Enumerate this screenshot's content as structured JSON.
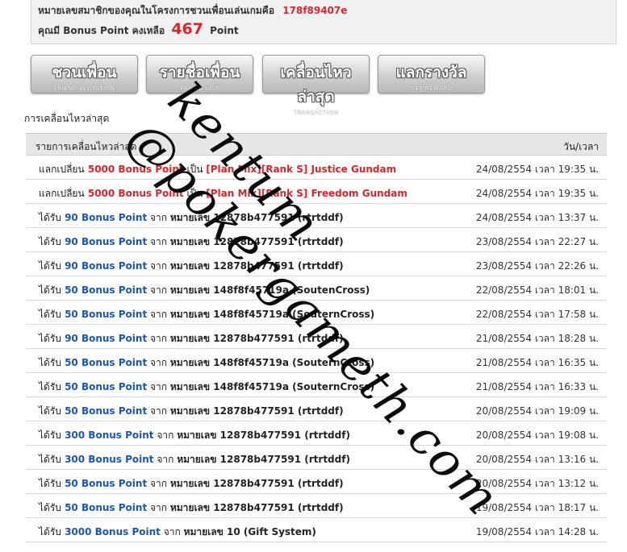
{
  "header": {
    "member_prefix": "หมายเลขสมาชิกของคุณในโครงการชวนเพื่อนเล่นเกมคือ",
    "member_id": "178f89407e",
    "points_prefix": "คุณมี Bonus Point คงเหลือ",
    "points_value": "467",
    "points_suffix": "Point"
  },
  "nav": [
    {
      "th": "ชวนเพื่อน",
      "en": "FRIEND INVITATION"
    },
    {
      "th": "รายชื่อเพื่อน",
      "en": "FRIEND LIST"
    },
    {
      "th": "เคลื่อนไหวล่าสุด",
      "en": "TRANSACTION"
    },
    {
      "th": "แลกรางวัล",
      "en": "GET REWARD"
    }
  ],
  "section_title": "การเคลื่อนไหวล่าสุด",
  "table": {
    "col_left": "รายการเคลื่อนไหวล่าสุด",
    "col_right": "วัน/เวลา",
    "rows": [
      {
        "act": "แลกเปลี่ยน",
        "amt": "5000 Bonus Point",
        "mid": " เป็น ",
        "item": "[Plan Mix][Rank S] Justice Gundam",
        "time": "24/08/2554 เวลา 19:35 น."
      },
      {
        "act": "แลกเปลี่ยน",
        "amt": "5000 Bonus Point",
        "mid": " เป็น ",
        "item": "[Plan Mix][Rank S] Freedom Gundam",
        "time": "24/08/2554 เวลา 19:35 น."
      },
      {
        "act": "ได้รับ",
        "amt": "90 Bonus Point",
        "frm": " จาก ",
        "src": "หมายเลข 12878b477591 (rtrtddf)",
        "time": "24/08/2554 เวลา 13:37 น."
      },
      {
        "act": "ได้รับ",
        "amt": "90 Bonus Point",
        "frm": " จาก ",
        "src": "หมายเลข 12878b477591 (rtrtddf)",
        "time": "23/08/2554 เวลา 22:27 น."
      },
      {
        "act": "ได้รับ",
        "amt": "90 Bonus Point",
        "frm": " จาก ",
        "src": "หมายเลข 12878b477591 (rtrtddf)",
        "time": "23/08/2554 เวลา 22:26 น."
      },
      {
        "act": "ได้รับ",
        "amt": "50 Bonus Point",
        "frm": " จาก ",
        "src": "หมายเลข 148f8f45719a (SoutenCross)",
        "time": "22/08/2554 เวลา 18:01 น."
      },
      {
        "act": "ได้รับ",
        "amt": "50 Bonus Point",
        "frm": " จาก ",
        "src": "หมายเลข 148f8f45719a (SouternCross)",
        "time": "22/08/2554 เวลา 17:58 น."
      },
      {
        "act": "ได้รับ",
        "amt": "90 Bonus Point",
        "frm": " จาก ",
        "src": "หมายเลข 12878b477591 (rtrtddf)",
        "time": "21/08/2554 เวลา 18:28 น."
      },
      {
        "act": "ได้รับ",
        "amt": "50 Bonus Point",
        "frm": " จาก ",
        "src": "หมายเลข 148f8f45719a (SouternCross)",
        "time": "21/08/2554 เวลา 16:35 น."
      },
      {
        "act": "ได้รับ",
        "amt": "50 Bonus Point",
        "frm": " จาก ",
        "src": "หมายเลข 148f8f45719a (SouternCross)",
        "time": "21/08/2554 เวลา 16:33 น."
      },
      {
        "act": "ได้รับ",
        "amt": "50 Bonus Point",
        "frm": " จาก ",
        "src": "หมายเลข 12878b477591 (rtrtddf)",
        "time": "20/08/2554 เวลา 19:09 น."
      },
      {
        "act": "ได้รับ",
        "amt": "300 Bonus Point",
        "frm": " จาก ",
        "src": "หมายเลข 12878b477591 (rtrtddf)",
        "time": "20/08/2554 เวลา 19:08 น."
      },
      {
        "act": "ได้รับ",
        "amt": "300 Bonus Point",
        "frm": " จาก ",
        "src": "หมายเลข 12878b477591 (rtrtddf)",
        "time": "20/08/2554 เวลา 13:16 น."
      },
      {
        "act": "ได้รับ",
        "amt": "50 Bonus Point",
        "frm": " จาก ",
        "src": "หมายเลข 12878b477591 (rtrtddf)",
        "time": "20/08/2554 เวลา 13:12 น."
      },
      {
        "act": "ได้รับ",
        "amt": "50 Bonus Point",
        "frm": " จาก ",
        "src": "หมายเลข 12878b477591 (rtrtddf)",
        "time": "19/08/2554 เวลา 18:17 น."
      },
      {
        "act": "ได้รับ",
        "amt": "3000 Bonus Point",
        "frm": " จาก ",
        "src": "หมายเลข 10 (Gift System)",
        "time": "19/08/2554 เวลา 14:28 น."
      }
    ]
  },
  "watermark": {
    "line1": "kentum",
    "line2": "@pokergameth.com"
  }
}
